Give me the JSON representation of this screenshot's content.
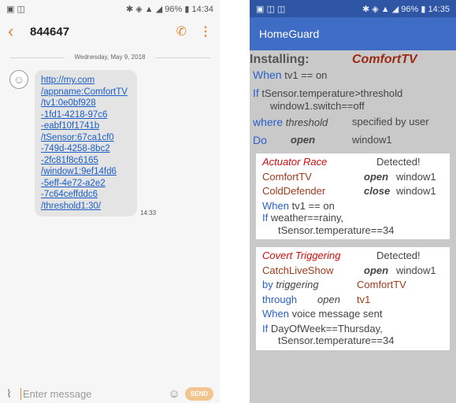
{
  "sms": {
    "status": {
      "time": "14:34",
      "battery": "96%"
    },
    "header": {
      "back_icon": "‹",
      "contact": "844647",
      "call_icon": "✆",
      "more_icon": "⋮"
    },
    "date": "Wednesday, May 9, 2018",
    "message_lines": [
      "http://my.com",
      "/appname:ComfortTV",
      "/tv1:0e0bf928",
      "-1fd1-4218-97c6",
      "-eabf10f1741b",
      "/tSensor:67ca1cf0",
      "-749d-4258-8bc2",
      "-2fc81f8c6165",
      "/window1:9ef14fd6",
      "-5eff-4e72-a2e2",
      "-7c64ceffddc6",
      "/threshold1:30/"
    ],
    "message_time": "14:33",
    "composer": {
      "placeholder": "Enter message",
      "send_label": "SEND"
    }
  },
  "hg": {
    "status": {
      "time": "14:35",
      "battery": "96%"
    },
    "title": "HomeGuard",
    "installing_label": "Installing:",
    "app_name": "ComfortTV",
    "when_kw": "When",
    "when_text": "tv1 == on",
    "if_kw": "If",
    "if_line1": "tSensor.temperature>threshold",
    "if_line2": "window1.switch==off",
    "where_kw": "where",
    "where_var": "threshold",
    "where_text": "specified by user",
    "do_kw": "Do",
    "do_action": "open",
    "do_target": "window1",
    "card1": {
      "title": "Actuator Race",
      "status": "Detected!",
      "row1": {
        "app": "ComfortTV",
        "action": "open",
        "target": "window1"
      },
      "row2": {
        "app": "ColdDefender",
        "action": "close",
        "target": "window1"
      },
      "when_kw": "When",
      "when_text": "tv1 == on",
      "if_kw": "If",
      "if_line1": "weather==rainy,",
      "if_line2": "tSensor.temperature==34"
    },
    "card2": {
      "title": "Covert Triggering",
      "status": "Detected!",
      "row1": {
        "app": "CatchLiveShow",
        "action": "open",
        "target": "window1"
      },
      "by_kw": "by",
      "by_text": "triggering",
      "by_app": "ComfortTV",
      "through_kw": "through",
      "through_action": "open",
      "through_target": "tv1",
      "when_kw": "When",
      "when_text": "voice message sent",
      "if_kw": "If",
      "if_line1": "DayOfWeek==Thursday,",
      "if_line2": "tSensor.temperature==34"
    }
  }
}
